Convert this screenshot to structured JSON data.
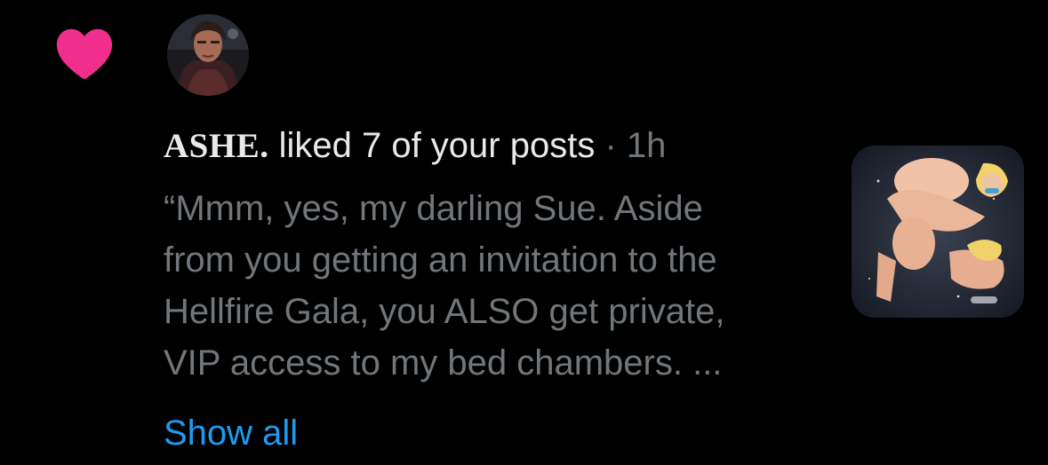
{
  "notification": {
    "type_icon": "heart-icon",
    "type_icon_color": "#f02f8c",
    "actor": {
      "avatar_icon": "avatar"
    },
    "headline": {
      "username": "ASHE.",
      "action": "liked 7 of your posts",
      "separator": "·",
      "time": "1h"
    },
    "preview": {
      "lines": [
        "“Mmm, yes, my darling Sue. Aside",
        "from you getting an invitation to the",
        "Hellfire Gala, you ALSO get private,",
        "VIP access to my bed chambers. ..."
      ]
    },
    "show_all_label": "Show all",
    "thumbnail_icon": "post-thumbnail-image"
  },
  "colors": {
    "background": "#000000",
    "primary_text": "#e7e9ea",
    "secondary_text": "#71767b",
    "link": "#1d9bf0",
    "like": "#f02f8c"
  }
}
